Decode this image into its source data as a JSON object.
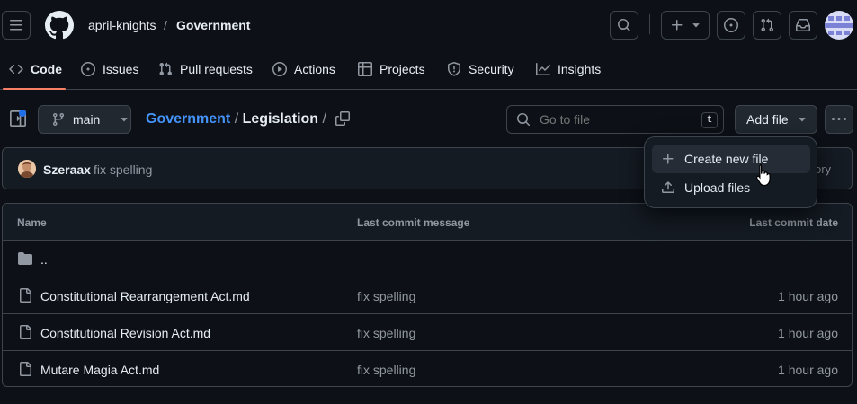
{
  "header": {
    "owner": "april-knights",
    "separator": "/",
    "repo": "Government"
  },
  "repo_nav": {
    "tabs": [
      {
        "label": "Code",
        "icon": "code-icon",
        "selected": true
      },
      {
        "label": "Issues",
        "icon": "issue-icon"
      },
      {
        "label": "Pull requests",
        "icon": "pull-request-icon"
      },
      {
        "label": "Actions",
        "icon": "play-icon"
      },
      {
        "label": "Projects",
        "icon": "table-icon"
      },
      {
        "label": "Security",
        "icon": "shield-icon"
      },
      {
        "label": "Insights",
        "icon": "graph-icon"
      }
    ]
  },
  "file_nav": {
    "branch": "main",
    "path_root": "Government",
    "path_sep": "/",
    "path_current": "Legislation",
    "path_trailing": "/",
    "search_placeholder": "Go to file",
    "search_shortcut": "t",
    "add_file_label": "Add file"
  },
  "commit": {
    "author": "Szeraax",
    "message": "fix spelling",
    "tail": "ory"
  },
  "table": {
    "col_name": "Name",
    "col_message": "Last commit message",
    "col_date": "Last commit date",
    "parent_dir": "..",
    "rows": [
      {
        "name": "Constitutional Rearrangement Act.md",
        "message": "fix spelling",
        "date": "1 hour ago"
      },
      {
        "name": "Constitutional Revision Act.md",
        "message": "fix spelling",
        "date": "1 hour ago"
      },
      {
        "name": "Mutare Magia Act.md",
        "message": "fix spelling",
        "date": "1 hour ago"
      }
    ]
  },
  "dropdown": {
    "items": [
      {
        "label": "Create new file",
        "icon": "plus-icon"
      },
      {
        "label": "Upload files",
        "icon": "upload-icon"
      }
    ]
  },
  "colors": {
    "background": "#0d1117",
    "accent_link": "#4493f8",
    "tab_underline": "#f78166"
  }
}
